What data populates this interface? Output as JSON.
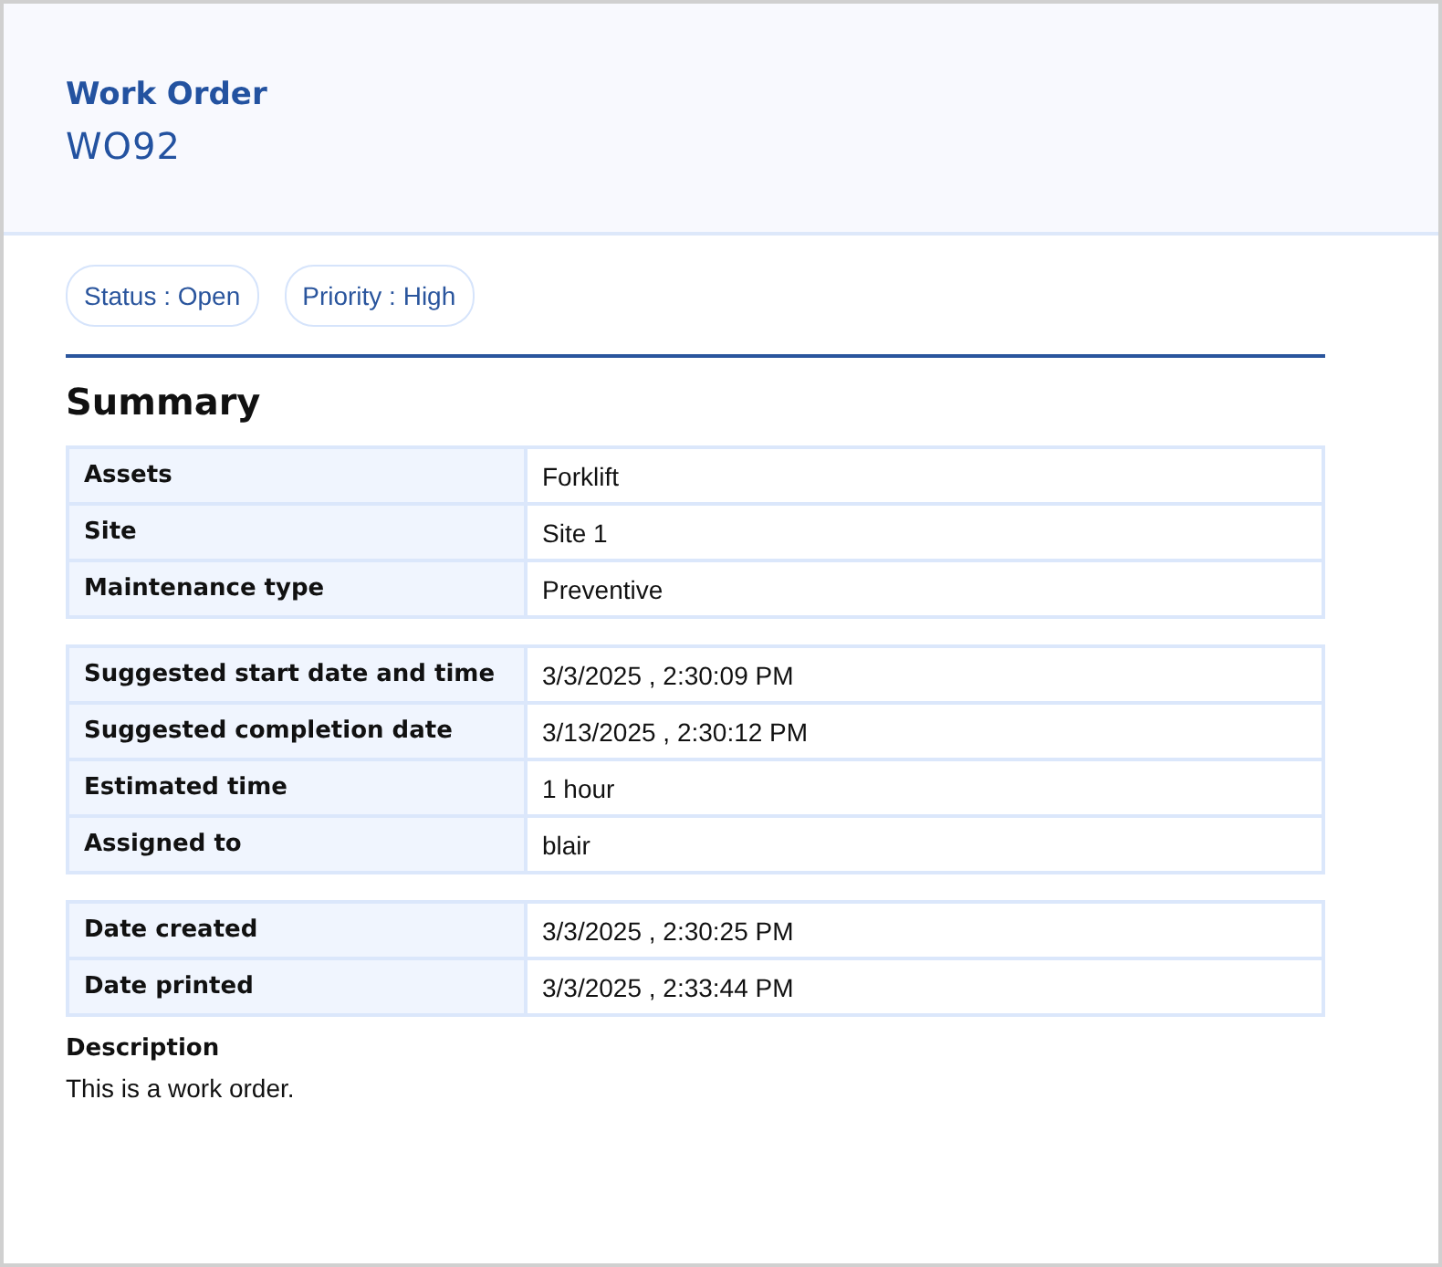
{
  "header": {
    "title": "Work Order",
    "number": "WO92"
  },
  "badges": [
    {
      "label": "Status : Open"
    },
    {
      "label": "Priority : High"
    }
  ],
  "summary": {
    "heading": "Summary",
    "groups": [
      {
        "rows": [
          {
            "label": "Assets",
            "value": "Forklift"
          },
          {
            "label": "Site",
            "value": "Site 1"
          },
          {
            "label": "Maintenance type",
            "value": "Preventive"
          }
        ]
      },
      {
        "rows": [
          {
            "label": "Suggested start date and time",
            "value": "3/3/2025 , 2:30:09 PM"
          },
          {
            "label": "Suggested completion date",
            "value": "3/13/2025 , 2:30:12 PM"
          },
          {
            "label": "Estimated time",
            "value": "1 hour"
          },
          {
            "label": "Assigned to",
            "value": "blair"
          }
        ]
      },
      {
        "rows": [
          {
            "label": "Date created",
            "value": "3/3/2025 , 2:30:25 PM"
          },
          {
            "label": "Date printed",
            "value": "3/3/2025 , 2:33:44 PM"
          }
        ]
      }
    ]
  },
  "description": {
    "heading": "Description",
    "text": "This is a work order."
  }
}
